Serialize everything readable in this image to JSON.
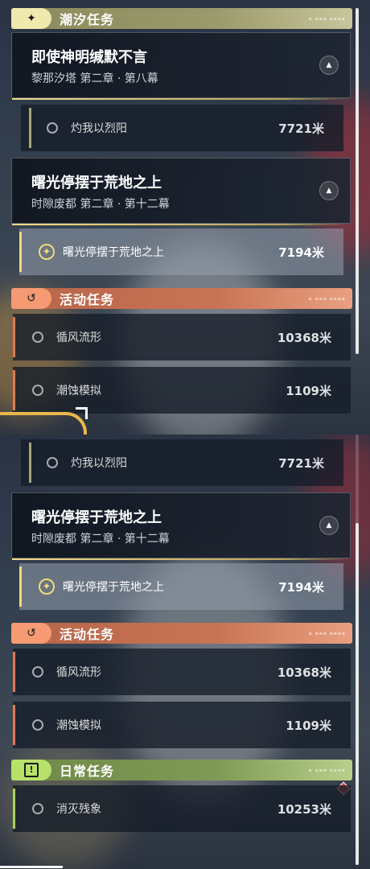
{
  "panel_top": {
    "tide_header": {
      "title": "潮汐任务",
      "icon": "star-sparkle-icon",
      "color": "#e8e4a6"
    },
    "main_quest_1": {
      "title": "即使神明缄默不言",
      "subtitle": "黎那汐塔 第二章 · 第八幕"
    },
    "row_1": {
      "label": "灼我以烈阳",
      "distance": "7721米"
    },
    "main_quest_2": {
      "title": "曙光停摆于荒地之上",
      "subtitle": "时隙废都 第二章 · 第十二幕"
    },
    "row_2_active": {
      "label": "曙光停摆于荒地之上",
      "distance": "7194米"
    },
    "event_header": {
      "title": "活动任务",
      "icon": "event-icon",
      "color": "#f08a5d"
    },
    "row_3": {
      "label": "循风流形",
      "distance": "10368米"
    },
    "row_4": {
      "label": "潮蚀模拟",
      "distance": "1109米"
    }
  },
  "panel_bottom": {
    "row_1": {
      "label": "灼我以烈阳",
      "distance": "7721米"
    },
    "main_quest_2": {
      "title": "曙光停摆于荒地之上",
      "subtitle": "时隙废都 第二章 · 第十二幕"
    },
    "row_2_active": {
      "label": "曙光停摆于荒地之上",
      "distance": "7194米"
    },
    "event_header": {
      "title": "活动任务",
      "icon": "event-icon",
      "color": "#f08a5d"
    },
    "row_3": {
      "label": "循风流形",
      "distance": "10368米"
    },
    "row_4": {
      "label": "潮蚀模拟",
      "distance": "1109米"
    },
    "daily_header": {
      "title": "日常任务",
      "icon": "alert-box-icon",
      "color": "#b6e26a"
    },
    "row_5": {
      "label": "消灭残象",
      "distance": "10253米"
    }
  },
  "colors": {
    "gold": "#f2d97a",
    "event_bar": "#e07a50",
    "daily_bar": "#a9d25a",
    "tide_bar": "#b9b07a"
  }
}
